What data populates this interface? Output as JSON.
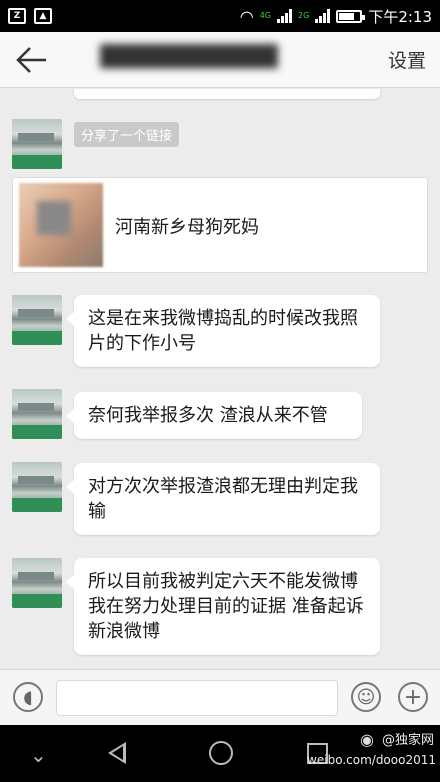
{
  "status_bar": {
    "time": "下午2:13",
    "network_labels": [
      "4G",
      "2G"
    ]
  },
  "header": {
    "title": "███████████",
    "settings_label": "设置"
  },
  "chat": {
    "share_label": "分享了一个链接",
    "link_title": "河南新乡母狗死妈",
    "messages": [
      "这是在来我微博捣乱的时候改我照片的下作小号",
      "奈何我举报多次 渣浪从来不管",
      "对方次次举报渣浪都无理由判定我输",
      "所以目前我被判定六天不能发微博 我在努力处理目前的证据 准备起诉新浪微博"
    ]
  },
  "watermark": {
    "brand": "@独家网",
    "url": "weibo.com/dooo2011"
  }
}
